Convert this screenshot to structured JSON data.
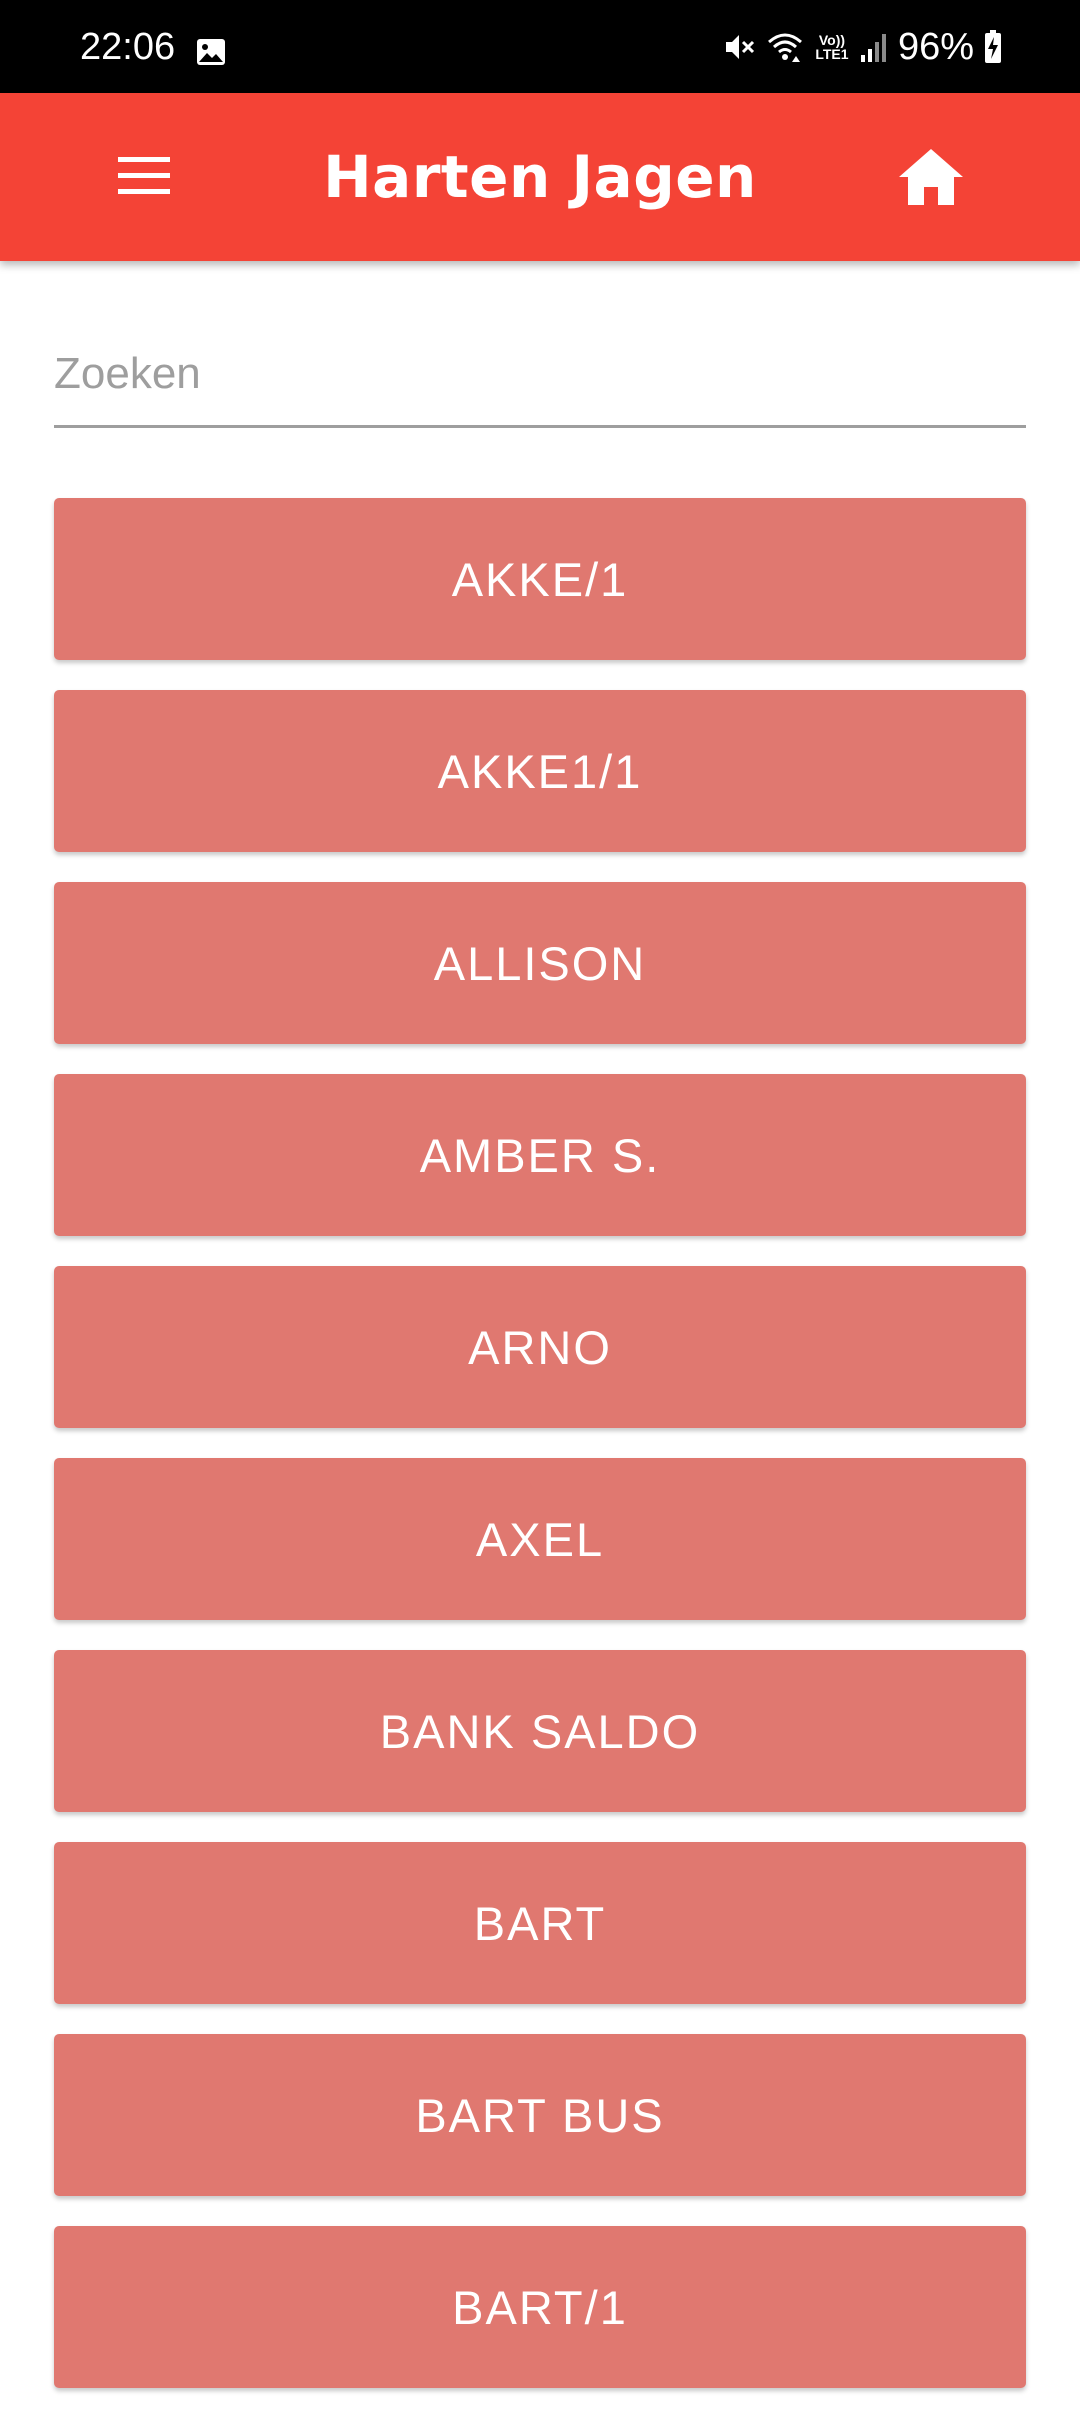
{
  "status_bar": {
    "time": "22:06",
    "volte_top": "Vo))",
    "volte_bottom": "LTE1",
    "battery": "96%",
    "icons": [
      "gallery-icon",
      "mute-icon",
      "wifi-icon",
      "signal-icon",
      "battery-charging-icon"
    ]
  },
  "app_bar": {
    "title": "Harten Jagen",
    "menu_icon": "hamburger-menu-icon",
    "home_icon": "home-icon",
    "color": "#f44336"
  },
  "search": {
    "placeholder": "Zoeken",
    "value": ""
  },
  "colors": {
    "item_background": "#e07870",
    "item_text": "#ffffff"
  },
  "items": [
    {
      "label": "AKKE/1"
    },
    {
      "label": "AKKE1/1"
    },
    {
      "label": "ALLISON"
    },
    {
      "label": "AMBER S."
    },
    {
      "label": "ARNO"
    },
    {
      "label": "AXEL"
    },
    {
      "label": "BANK SALDO"
    },
    {
      "label": "BART"
    },
    {
      "label": "BART BUS"
    },
    {
      "label": "BART/1"
    }
  ]
}
